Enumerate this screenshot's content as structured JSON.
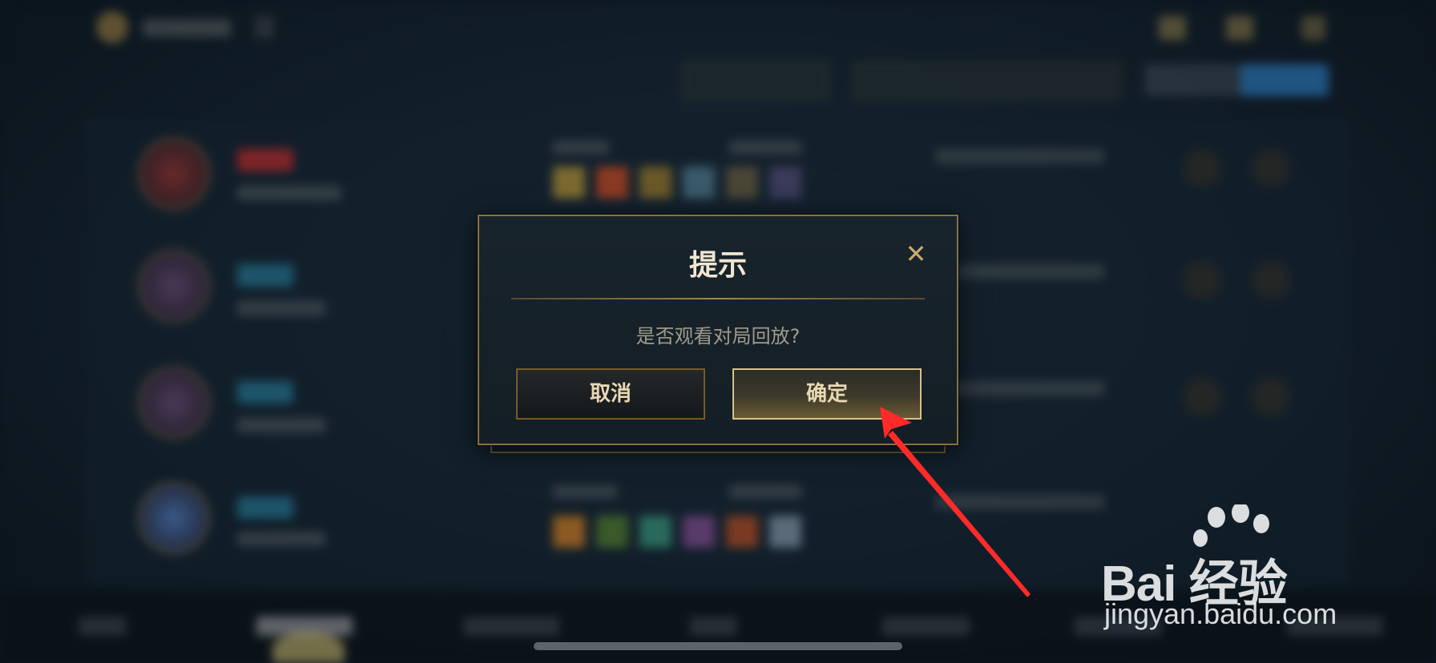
{
  "dialog": {
    "title": "提示",
    "message": "是否观看对局回放?",
    "cancel_label": "取消",
    "confirm_label": "确定",
    "close_icon": "close-icon",
    "accent_color": "#c8aa6e"
  },
  "watermark": {
    "brand": "Bai 经验",
    "url": "jingyan.baidu.com"
  },
  "annotation": {
    "arrow_color": "#ff2a2a"
  }
}
